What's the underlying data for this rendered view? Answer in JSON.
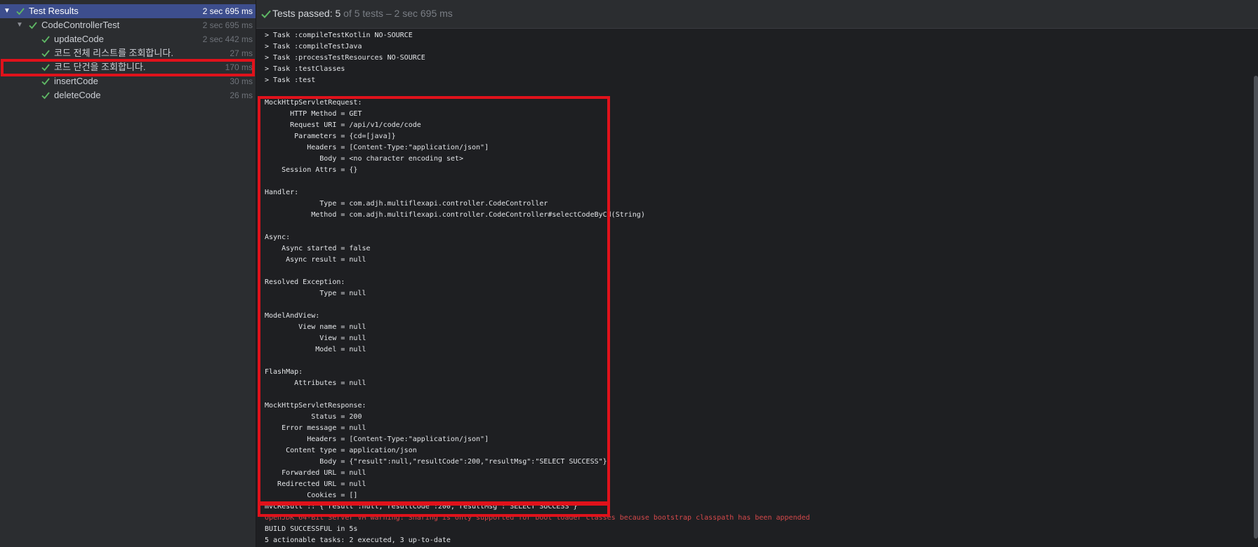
{
  "tree": {
    "root": {
      "label": "Test Results",
      "duration": "2 sec 695 ms"
    },
    "suite": {
      "label": "CodeControllerTest",
      "duration": "2 sec 695 ms"
    },
    "tests": [
      {
        "label": "updateCode",
        "duration": "2 sec 442 ms"
      },
      {
        "label": "코드 전체 리스트를 조회합니다.",
        "duration": "27 ms"
      },
      {
        "label": "코드 단건을 조회합니다.",
        "duration": "170 ms"
      },
      {
        "label": "insertCode",
        "duration": "30 ms"
      },
      {
        "label": "deleteCode",
        "duration": "26 ms"
      }
    ]
  },
  "status": {
    "main": "Tests passed: 5",
    "sub": " of 5 tests – 2 sec 695 ms"
  },
  "colors": {
    "pass_green": "#5fb865",
    "highlight_red": "#e0121b",
    "error_text": "#d6494b",
    "selection": "#3d4e8d"
  },
  "log_lines": [
    "> Task :compileTestKotlin NO-SOURCE",
    "> Task :compileTestJava",
    "> Task :processTestResources NO-SOURCE",
    "> Task :testClasses",
    "> Task :test",
    "",
    "MockHttpServletRequest:",
    "      HTTP Method = GET",
    "      Request URI = /api/v1/code/code",
    "       Parameters = {cd=[java]}",
    "          Headers = [Content-Type:\"application/json\"]",
    "             Body = <no character encoding set>",
    "    Session Attrs = {}",
    "",
    "Handler:",
    "             Type = com.adjh.multiflexapi.controller.CodeController",
    "           Method = com.adjh.multiflexapi.controller.CodeController#selectCodeByCd(String)",
    "",
    "Async:",
    "    Async started = false",
    "     Async result = null",
    "",
    "Resolved Exception:",
    "             Type = null",
    "",
    "ModelAndView:",
    "        View name = null",
    "             View = null",
    "            Model = null",
    "",
    "FlashMap:",
    "       Attributes = null",
    "",
    "MockHttpServletResponse:",
    "           Status = 200",
    "    Error message = null",
    "          Headers = [Content-Type:\"application/json\"]",
    "     Content type = application/json",
    "             Body = {\"result\":null,\"resultCode\":200,\"resultMsg\":\"SELECT SUCCESS\"}",
    "    Forwarded URL = null",
    "   Redirected URL = null",
    "          Cookies = []",
    "mvcResult :: {\"result\":null,\"resultCode\":200,\"resultMsg\":\"SELECT SUCCESS\"}",
    "OpenJDK 64-Bit Server VM warning: Sharing is only supported for boot loader classes because bootstrap classpath has been appended",
    "BUILD SUCCESSFUL in 5s",
    "5 actionable tasks: 2 executed, 3 up-to-date"
  ]
}
